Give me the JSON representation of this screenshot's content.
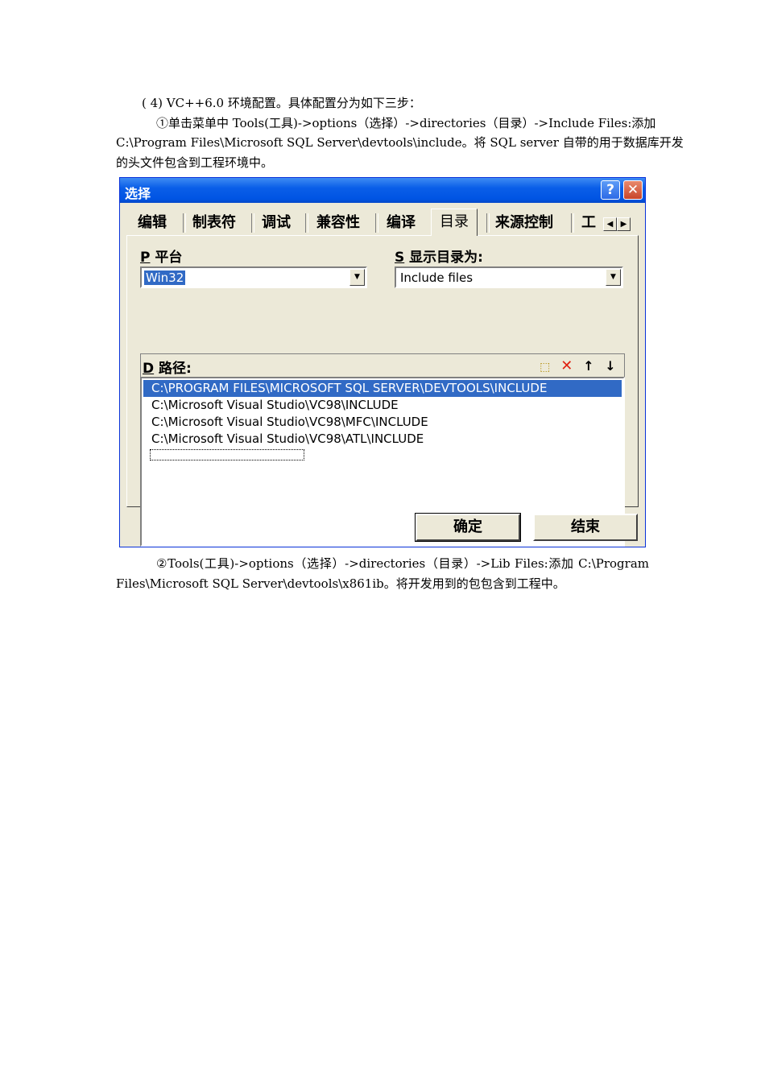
{
  "doc": {
    "para1_lines": [
      "( 4) VC++6.0 环境配置。具体配置分为如下三步：",
      "①单击菜单中 Tools(工具)->options（选择）->directories（目录）->Include Files:添加",
      "C:\\Program Files\\Microsoft SQL Server\\devtools\\include。将 SQL server 自带的用于数据库开发",
      "的头文件包含到工程环境中。"
    ],
    "para2_lines": [
      "②Tools(工具)->options（选择）->directories（目录）->Lib Files:添加 C:\\Program",
      "Files\\Microsoft SQL Server\\devtools\\x861ib。将开发用到的包包含到工程中。"
    ]
  },
  "dialog": {
    "title": "选择",
    "help_glyph": "?",
    "close_glyph": "✕",
    "tabs": [
      "编辑",
      "制表符",
      "调试",
      "兼容性",
      "编译",
      "目录",
      "来源控制",
      "工"
    ],
    "active_tab": "目录",
    "scroll_left": "◀",
    "scroll_right": "▶",
    "platform": {
      "hotkey": "P",
      "label": "平台",
      "value": "Win32"
    },
    "show_dirs": {
      "hotkey": "S",
      "label": "显示目录为:",
      "value": "Include files"
    },
    "dropdown_glyph": "▼",
    "path": {
      "hotkey": "D",
      "label": "路径:"
    },
    "tool_icons": {
      "new": "⬚",
      "delete": "✕",
      "up": "↑",
      "down": "↓"
    },
    "paths": [
      "C:\\PROGRAM FILES\\MICROSOFT SQL SERVER\\DEVTOOLS\\INCLUDE",
      "C:\\Microsoft Visual Studio\\VC98\\INCLUDE",
      "C:\\Microsoft Visual Studio\\VC98\\MFC\\INCLUDE",
      "C:\\Microsoft Visual Studio\\VC98\\ATL\\INCLUDE"
    ],
    "ok_label": "确定",
    "finish_label": "结束"
  }
}
